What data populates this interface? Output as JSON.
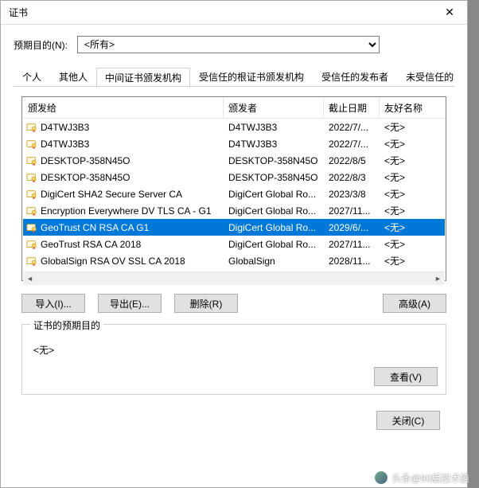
{
  "window": {
    "title": "证书"
  },
  "purpose": {
    "label": "预期目的(N):",
    "selected": "<所有>"
  },
  "tabs": [
    {
      "label": "个人"
    },
    {
      "label": "其他人"
    },
    {
      "label": "中间证书颁发机构",
      "active": true
    },
    {
      "label": "受信任的根证书颁发机构"
    },
    {
      "label": "受信任的发布者"
    },
    {
      "label": "未受信任的发布者"
    }
  ],
  "columns": {
    "issuedTo": "颁发给",
    "issuedBy": "颁发者",
    "expires": "截止日期",
    "friendly": "友好名称"
  },
  "rows": [
    {
      "to": "D4TWJ3B3",
      "by": "D4TWJ3B3",
      "exp": "2022/7/...",
      "fn": "<无>"
    },
    {
      "to": "D4TWJ3B3",
      "by": "D4TWJ3B3",
      "exp": "2022/7/...",
      "fn": "<无>"
    },
    {
      "to": "DESKTOP-358N45O",
      "by": "DESKTOP-358N45O",
      "exp": "2022/8/5",
      "fn": "<无>"
    },
    {
      "to": "DESKTOP-358N45O",
      "by": "DESKTOP-358N45O",
      "exp": "2022/8/3",
      "fn": "<无>"
    },
    {
      "to": "DigiCert SHA2 Secure Server CA",
      "by": "DigiCert Global Ro...",
      "exp": "2023/3/8",
      "fn": "<无>"
    },
    {
      "to": "Encryption Everywhere DV TLS CA - G1",
      "by": "DigiCert Global Ro...",
      "exp": "2027/11...",
      "fn": "<无>"
    },
    {
      "to": "GeoTrust CN RSA CA G1",
      "by": "DigiCert Global Ro...",
      "exp": "2029/6/...",
      "fn": "<无>",
      "selected": true
    },
    {
      "to": "GeoTrust RSA CA 2018",
      "by": "DigiCert Global Ro...",
      "exp": "2027/11...",
      "fn": "<无>"
    },
    {
      "to": "GlobalSign RSA OV SSL CA 2018",
      "by": "GlobalSign",
      "exp": "2028/11...",
      "fn": "<无>"
    }
  ],
  "buttons": {
    "import": "导入(I)...",
    "export": "导出(E)...",
    "remove": "删除(R)",
    "advanced": "高级(A)",
    "view": "查看(V)",
    "close": "关闭(C)"
  },
  "intended": {
    "title": "证书的预期目的",
    "value": "<无>"
  },
  "watermark": "头条@90后技术猿"
}
